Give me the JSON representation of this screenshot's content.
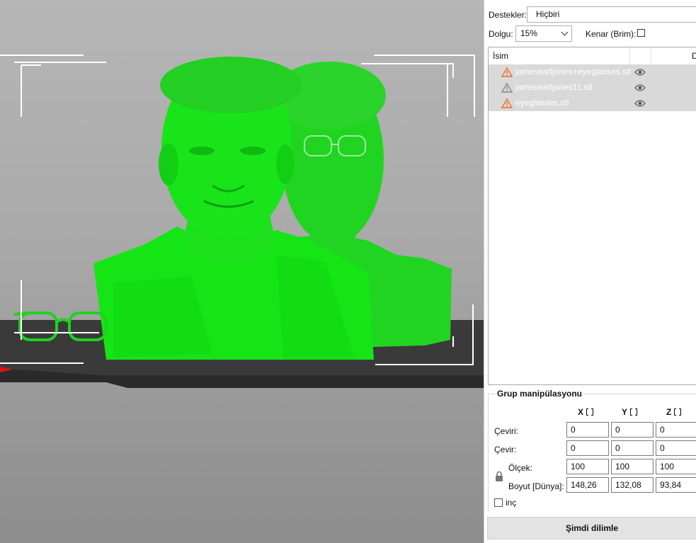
{
  "panel": {
    "supports": {
      "label": "Destekler:",
      "value": "Hiçbiri"
    },
    "infill": {
      "label": "Dolgu:",
      "value": "15%"
    },
    "brim": {
      "label": "Kenar (Brim):"
    },
    "list": {
      "col_name": "İsim",
      "col_d": "D",
      "items": [
        {
          "name": "jamesearljones+eyeglasses.stl",
          "warning": "orange"
        },
        {
          "name": "jamesearljones11.stl",
          "warning": "gray"
        },
        {
          "name": "eyeglasses.stl",
          "warning": "orange"
        }
      ]
    },
    "group": {
      "title": "Grup manipülasyonu",
      "axes": [
        "X",
        "Y",
        "Z"
      ],
      "rows": [
        {
          "label": "Çeviri:",
          "values": [
            "0",
            "0",
            "0"
          ]
        },
        {
          "label": "Çevir:",
          "values": [
            "0",
            "0",
            "0"
          ]
        },
        {
          "label": "Ölçek:",
          "values": [
            "100",
            "100",
            "100"
          ]
        },
        {
          "label": "Boyut [Dünya]:",
          "values": [
            "148,26",
            "132,08",
            "93,84"
          ]
        }
      ],
      "inch_label": "inç"
    },
    "slice_button": "Şimdi dilimle"
  },
  "colors": {
    "model_green": "#19e619",
    "viewport_bg": "#a9a9a9",
    "bed": "#3b3b3b",
    "warning_orange": "#e8702a",
    "warning_gray": "#8a8a8a"
  }
}
